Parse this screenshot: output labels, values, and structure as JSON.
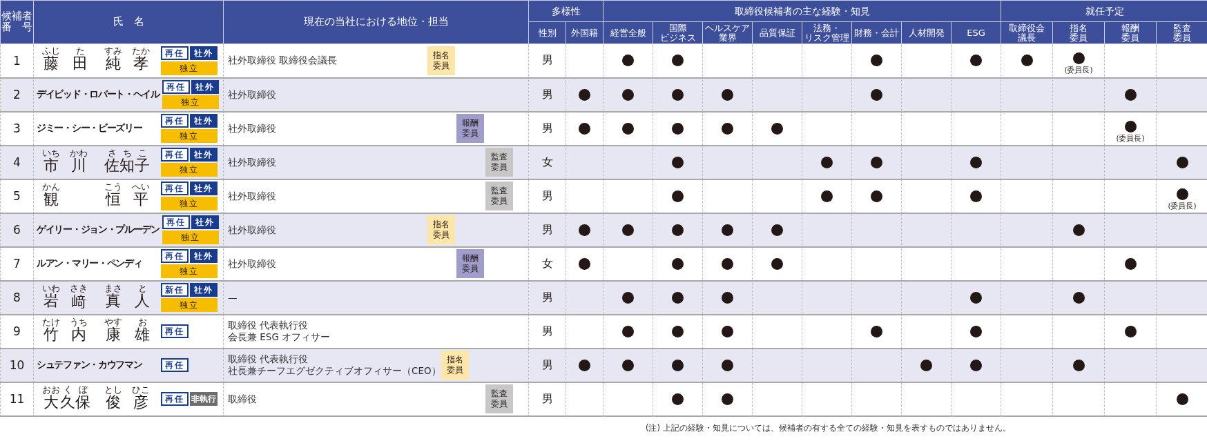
{
  "header": {
    "number": [
      "候補者",
      "番　号"
    ],
    "name": "氏　名",
    "position": "現在の当社における地位・担当",
    "groups": [
      {
        "label": "多様性"
      },
      {
        "label": "取締役候補者の主な経験・知見"
      },
      {
        "label": "就任予定"
      }
    ],
    "columns": [
      {
        "lines": [
          "性別"
        ]
      },
      {
        "lines": [
          "外国籍"
        ]
      },
      {
        "lines": [
          "経営全般"
        ]
      },
      {
        "lines": [
          "国際",
          "ビジネス"
        ]
      },
      {
        "lines": [
          "ヘルスケア",
          "業界"
        ]
      },
      {
        "lines": [
          "品質保証"
        ]
      },
      {
        "lines": [
          "法務・",
          "リスク管理"
        ]
      },
      {
        "lines": [
          "財務・会計"
        ]
      },
      {
        "lines": [
          "人材開発"
        ]
      },
      {
        "lines": [
          "ESG"
        ]
      },
      {
        "lines": [
          "取締役会",
          "議長"
        ]
      },
      {
        "lines": [
          "指名",
          "委員"
        ]
      },
      {
        "lines": [
          "報酬",
          "委員"
        ]
      },
      {
        "lines": [
          "監査",
          "委員"
        ]
      }
    ]
  },
  "rows": [
    {
      "number": "1",
      "name": {
        "kind": "ruby",
        "family": [
          {
            "base": "藤",
            "ruby": "ふじ"
          },
          {
            "base": "田",
            "ruby": "た"
          }
        ],
        "given": [
          {
            "base": "純",
            "ruby": "すみ"
          },
          {
            "base": "孝",
            "ruby": "たか"
          }
        ]
      },
      "tags": [
        {
          "label": "再任",
          "kind": "term"
        },
        {
          "label": "社外",
          "kind": "outside"
        },
        {
          "label": "独立",
          "kind": "independent"
        }
      ],
      "position": [
        "社外取締役 取締役会議長"
      ],
      "committee": {
        "label": "指名委員",
        "kind": "nomination"
      },
      "gender": "男",
      "marks": [
        false,
        true,
        true,
        false,
        false,
        false,
        true,
        false,
        true,
        true,
        true,
        false,
        false
      ],
      "note": {
        "kind": "nomination",
        "text": "(委員長)"
      }
    },
    {
      "number": "2",
      "name": {
        "kind": "plain",
        "text": "デイビッド・ロバート・ヘイル"
      },
      "tags": [
        {
          "label": "再任",
          "kind": "term"
        },
        {
          "label": "社外",
          "kind": "outside"
        },
        {
          "label": "独立",
          "kind": "independent"
        }
      ],
      "position": [
        "社外取締役"
      ],
      "gender": "男",
      "marks": [
        true,
        true,
        true,
        true,
        false,
        false,
        true,
        false,
        false,
        false,
        false,
        true,
        false
      ]
    },
    {
      "number": "3",
      "name": {
        "kind": "plain",
        "text": "ジミー・シー・ビーズリー"
      },
      "tags": [
        {
          "label": "再任",
          "kind": "term"
        },
        {
          "label": "社外",
          "kind": "outside"
        },
        {
          "label": "独立",
          "kind": "independent"
        }
      ],
      "position": [
        "社外取締役"
      ],
      "committee": {
        "label": "報酬委員",
        "kind": "compensation"
      },
      "gender": "男",
      "marks": [
        true,
        true,
        true,
        true,
        true,
        false,
        false,
        false,
        false,
        false,
        false,
        true,
        false
      ],
      "note": {
        "kind": "compensation",
        "text": "(委員長)"
      }
    },
    {
      "number": "4",
      "name": {
        "kind": "ruby",
        "family": [
          {
            "base": "市",
            "ruby": "いち"
          },
          {
            "base": "川",
            "ruby": "かわ"
          }
        ],
        "given": [
          {
            "base": "佐",
            "ruby": "さ"
          },
          {
            "base": "知",
            "ruby": "ち"
          },
          {
            "base": "子",
            "ruby": "こ"
          }
        ]
      },
      "tags": [
        {
          "label": "再任",
          "kind": "term"
        },
        {
          "label": "社外",
          "kind": "outside"
        },
        {
          "label": "独立",
          "kind": "independent"
        }
      ],
      "position": [
        "社外取締役"
      ],
      "committee": {
        "label": "監査委員",
        "kind": "audit"
      },
      "gender": "女",
      "marks": [
        false,
        false,
        true,
        false,
        false,
        true,
        true,
        false,
        true,
        false,
        false,
        false,
        true
      ]
    },
    {
      "number": "5",
      "name": {
        "kind": "ruby",
        "family": [
          {
            "base": "観",
            "ruby": "かん"
          }
        ],
        "given": [
          {
            "base": "恒",
            "ruby": "こう"
          },
          {
            "base": "平",
            "ruby": "へい"
          }
        ]
      },
      "tags": [
        {
          "label": "再任",
          "kind": "term"
        },
        {
          "label": "社外",
          "kind": "outside"
        },
        {
          "label": "独立",
          "kind": "independent"
        }
      ],
      "position": [
        "社外取締役"
      ],
      "committee": {
        "label": "監査委員",
        "kind": "audit"
      },
      "gender": "男",
      "marks": [
        false,
        false,
        true,
        false,
        false,
        true,
        true,
        false,
        true,
        false,
        false,
        false,
        true
      ],
      "note": {
        "kind": "audit",
        "text": "(委員長)"
      }
    },
    {
      "number": "6",
      "name": {
        "kind": "plain",
        "text": "ゲイリー・ジョン・プルーデン"
      },
      "tags": [
        {
          "label": "再任",
          "kind": "term"
        },
        {
          "label": "社外",
          "kind": "outside"
        },
        {
          "label": "独立",
          "kind": "independent"
        }
      ],
      "position": [
        "社外取締役"
      ],
      "committee": {
        "label": "指名委員",
        "kind": "nomination"
      },
      "gender": "男",
      "marks": [
        true,
        true,
        true,
        true,
        true,
        false,
        false,
        false,
        false,
        false,
        true,
        false,
        false
      ]
    },
    {
      "number": "7",
      "name": {
        "kind": "plain",
        "text": "ルアン・マリー・ペンディ"
      },
      "tags": [
        {
          "label": "再任",
          "kind": "term"
        },
        {
          "label": "社外",
          "kind": "outside"
        },
        {
          "label": "独立",
          "kind": "independent"
        }
      ],
      "position": [
        "社外取締役"
      ],
      "committee": {
        "label": "報酬委員",
        "kind": "compensation"
      },
      "gender": "女",
      "marks": [
        true,
        false,
        true,
        true,
        true,
        false,
        false,
        false,
        false,
        false,
        false,
        true,
        false
      ]
    },
    {
      "number": "8",
      "name": {
        "kind": "ruby",
        "family": [
          {
            "base": "岩",
            "ruby": "いわ"
          },
          {
            "base": "﨑",
            "ruby": "さき"
          }
        ],
        "given": [
          {
            "base": "真",
            "ruby": "まさ"
          },
          {
            "base": "人",
            "ruby": "と"
          }
        ]
      },
      "tags": [
        {
          "label": "新任",
          "kind": "term"
        },
        {
          "label": "社外",
          "kind": "outside"
        },
        {
          "label": "独立",
          "kind": "independent"
        }
      ],
      "position": [
        "—"
      ],
      "gender": "男",
      "marks": [
        false,
        true,
        true,
        true,
        false,
        false,
        false,
        false,
        true,
        false,
        true,
        false,
        false
      ]
    },
    {
      "number": "9",
      "name": {
        "kind": "ruby",
        "family": [
          {
            "base": "竹",
            "ruby": "たけ"
          },
          {
            "base": "内",
            "ruby": "うち"
          }
        ],
        "given": [
          {
            "base": "康",
            "ruby": "やす"
          },
          {
            "base": "雄",
            "ruby": "お"
          }
        ]
      },
      "tags": [
        {
          "label": "再任",
          "kind": "term"
        }
      ],
      "position": [
        "取締役 代表執行役",
        "会長兼 ESG オフィサー"
      ],
      "gender": "男",
      "marks": [
        false,
        true,
        true,
        true,
        false,
        false,
        true,
        false,
        true,
        false,
        false,
        true,
        false
      ]
    },
    {
      "number": "10",
      "name": {
        "kind": "plain",
        "text": "シュテファン・カウフマン"
      },
      "tags": [
        {
          "label": "再任",
          "kind": "term"
        }
      ],
      "position": [
        "取締役 代表執行役",
        "社長兼チーフエグゼクティブオフィサー（CEO）"
      ],
      "committee": {
        "label": "指名委員",
        "kind": "nomination"
      },
      "gender": "男",
      "marks": [
        true,
        true,
        true,
        true,
        false,
        false,
        false,
        true,
        true,
        false,
        true,
        false,
        false
      ]
    },
    {
      "number": "11",
      "name": {
        "kind": "ruby",
        "family": [
          {
            "base": "大",
            "ruby": "おお"
          },
          {
            "base": "久",
            "ruby": "く"
          },
          {
            "base": "保",
            "ruby": "ぼ"
          }
        ],
        "given": [
          {
            "base": "俊",
            "ruby": "とし"
          },
          {
            "base": "彦",
            "ruby": "ひこ"
          }
        ]
      },
      "tags": [
        {
          "label": "再任",
          "kind": "term"
        },
        {
          "label": "非執行",
          "kind": "nonexecutive"
        }
      ],
      "position": [
        "取締役"
      ],
      "committee": {
        "label": "監査委員",
        "kind": "audit"
      },
      "gender": "男",
      "marks": [
        false,
        false,
        true,
        true,
        false,
        false,
        false,
        false,
        false,
        false,
        false,
        false,
        true
      ]
    }
  ],
  "footnote": "(注) 上記の経験・知見については、候補者の有する全ての経験・知見を表すものではありません。"
}
